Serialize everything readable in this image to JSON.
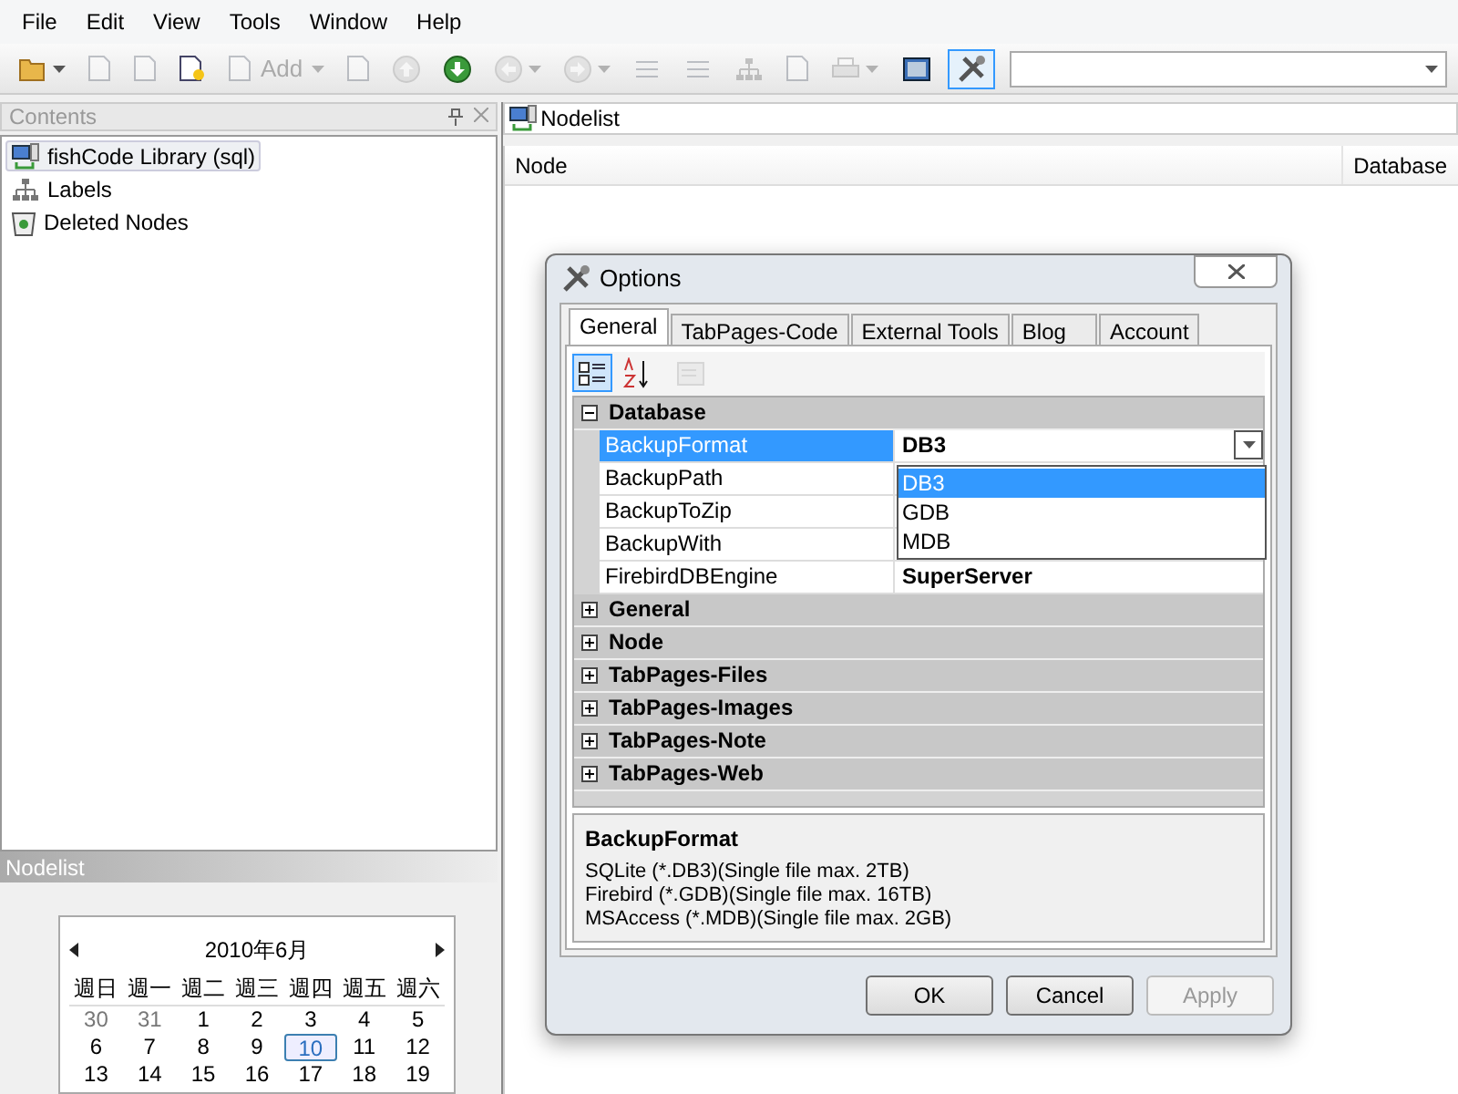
{
  "menu": [
    "File",
    "Edit",
    "View",
    "Tools",
    "Window",
    "Help"
  ],
  "toolbar": [
    {
      "kind": "folder",
      "disabled": false,
      "dropdown": true
    },
    {
      "kind": "page",
      "disabled": true,
      "dropdown": false
    },
    {
      "kind": "page",
      "disabled": true,
      "dropdown": false
    },
    {
      "kind": "page-star",
      "disabled": false,
      "dropdown": false
    },
    {
      "kind": "add",
      "label": "Add",
      "disabled": true,
      "dropdown": true
    },
    {
      "kind": "page",
      "disabled": true,
      "dropdown": false
    },
    {
      "kind": "arrow-up",
      "disabled": true,
      "dropdown": false
    },
    {
      "kind": "arrow-down",
      "disabled": false,
      "dropdown": false
    },
    {
      "kind": "arrow-left",
      "disabled": true,
      "dropdown": true
    },
    {
      "kind": "arrow-right",
      "disabled": true,
      "dropdown": true
    },
    {
      "kind": "lines",
      "disabled": true,
      "dropdown": false
    },
    {
      "kind": "lines",
      "disabled": true,
      "dropdown": false
    },
    {
      "kind": "tree",
      "disabled": true,
      "dropdown": false
    },
    {
      "kind": "page",
      "disabled": true,
      "dropdown": false
    },
    {
      "kind": "print",
      "disabled": true,
      "dropdown": true
    },
    {
      "kind": "screen",
      "disabled": false,
      "dropdown": false
    },
    {
      "kind": "tools",
      "disabled": false,
      "dropdown": false,
      "selected": true
    }
  ],
  "contents": {
    "title": "Contents",
    "items": [
      {
        "kind": "database",
        "label": "fishCode Library (sql)",
        "selected": true
      },
      {
        "kind": "tree",
        "label": "Labels",
        "selected": false
      },
      {
        "kind": "bin",
        "label": "Deleted Nodes",
        "selected": false
      }
    ]
  },
  "nodelist_panel": {
    "title": "Nodelist"
  },
  "calendar": {
    "month": "2010年6月",
    "weekdays": [
      "週日",
      "週一",
      "週二",
      "週三",
      "週四",
      "週五",
      "週六"
    ],
    "weeks": [
      [
        {
          "day": "30",
          "other_month": true,
          "selected": false
        },
        {
          "day": "31",
          "other_month": true,
          "selected": false
        },
        {
          "day": "1",
          "other_month": false,
          "selected": false
        },
        {
          "day": "2",
          "other_month": false,
          "selected": false
        },
        {
          "day": "3",
          "other_month": false,
          "selected": false
        },
        {
          "day": "4",
          "other_month": false,
          "selected": false
        },
        {
          "day": "5",
          "other_month": false,
          "selected": false
        }
      ],
      [
        {
          "day": "6",
          "other_month": false,
          "selected": false
        },
        {
          "day": "7",
          "other_month": false,
          "selected": false
        },
        {
          "day": "8",
          "other_month": false,
          "selected": false
        },
        {
          "day": "9",
          "other_month": false,
          "selected": false
        },
        {
          "day": "10",
          "other_month": false,
          "selected": true
        },
        {
          "day": "11",
          "other_month": false,
          "selected": false
        },
        {
          "day": "12",
          "other_month": false,
          "selected": false
        }
      ],
      [
        {
          "day": "13",
          "other_month": false,
          "selected": false
        },
        {
          "day": "14",
          "other_month": false,
          "selected": false
        },
        {
          "day": "15",
          "other_month": false,
          "selected": false
        },
        {
          "day": "16",
          "other_month": false,
          "selected": false
        },
        {
          "day": "17",
          "other_month": false,
          "selected": false
        },
        {
          "day": "18",
          "other_month": false,
          "selected": false
        },
        {
          "day": "19",
          "other_month": false,
          "selected": false
        }
      ]
    ]
  },
  "document": {
    "tab": "Nodelist",
    "columns": [
      "Node",
      "Database"
    ]
  },
  "dialog": {
    "title": "Options",
    "tabs": [
      {
        "label": "General",
        "selected": true
      },
      {
        "label": "TabPages-Code",
        "selected": false
      },
      {
        "label": "External Tools",
        "selected": false
      },
      {
        "label": "Blog",
        "selected": false
      },
      {
        "label": "Account",
        "selected": false
      }
    ],
    "view_buttons": [
      {
        "kind": "categorized",
        "selected": true,
        "disabled": false
      },
      {
        "kind": "alphabetical",
        "selected": false,
        "disabled": false
      },
      {
        "kind": "pages",
        "selected": false,
        "disabled": true
      }
    ],
    "categories": [
      {
        "name": "Database",
        "expanded": true,
        "properties": [
          {
            "name": "BackupFormat",
            "value": "DB3",
            "selected": true
          },
          {
            "name": "BackupPath",
            "selected": false
          },
          {
            "name": "BackupToZip",
            "selected": false
          },
          {
            "name": "BackupWith",
            "selected": false
          },
          {
            "name": "FirebirdDBEngine",
            "value": "SuperServer",
            "selected": false
          }
        ]
      },
      {
        "name": "General",
        "expanded": false
      },
      {
        "name": "Node",
        "expanded": false
      },
      {
        "name": "TabPages-Files",
        "expanded": false
      },
      {
        "name": "TabPages-Images",
        "expanded": false
      },
      {
        "name": "TabPages-Note",
        "expanded": false
      },
      {
        "name": "TabPages-Web",
        "expanded": false
      }
    ],
    "dropdown": [
      {
        "label": "DB3",
        "selected": true
      },
      {
        "label": "GDB",
        "selected": false
      },
      {
        "label": "MDB",
        "selected": false
      }
    ],
    "description": {
      "title": "BackupFormat",
      "lines": [
        "SQLite (*.DB3)(Single file max. 2TB)",
        "Firebird (*.GDB)(Single file max. 16TB)",
        "MSAccess (*.MDB)(Single file max. 2GB)"
      ]
    },
    "buttons": [
      {
        "label": "OK",
        "disabled": false
      },
      {
        "label": "Cancel",
        "disabled": false
      },
      {
        "label": "Apply",
        "disabled": true
      }
    ]
  }
}
